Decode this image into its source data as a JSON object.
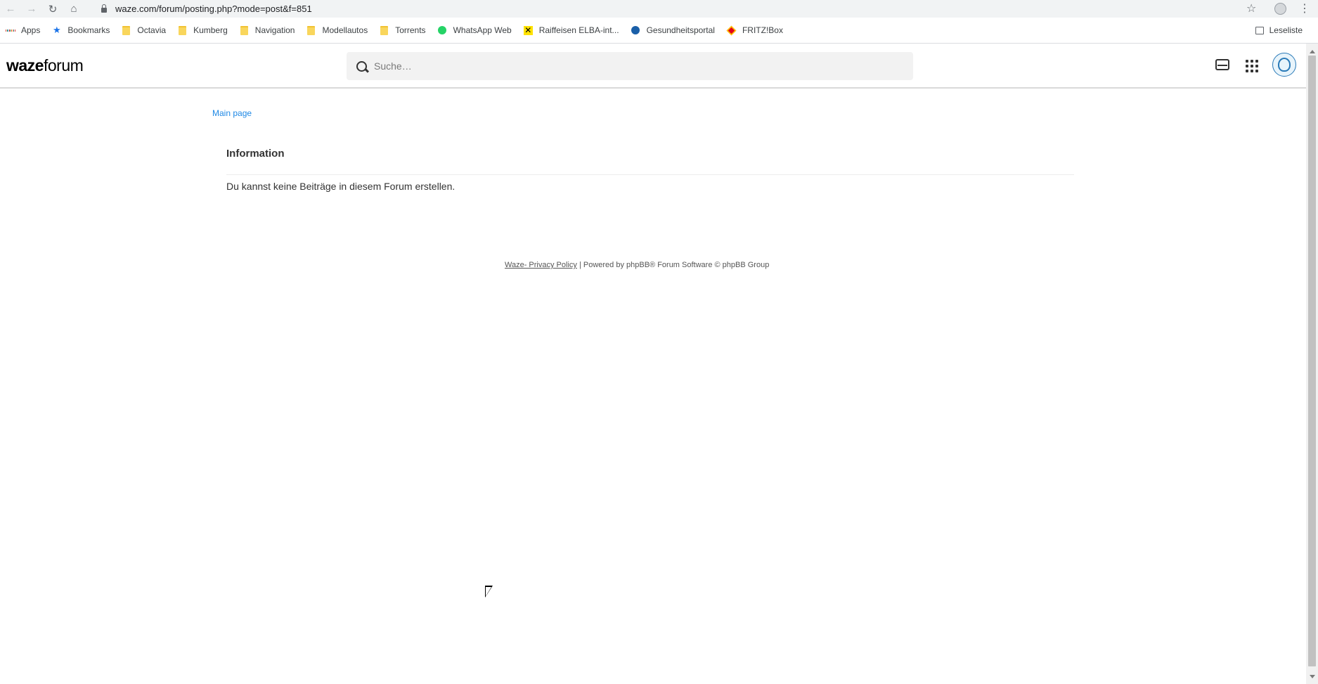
{
  "browser": {
    "url": "waze.com/forum/posting.php?mode=post&f=851",
    "icons": [
      "back-icon",
      "forward-icon",
      "reload-icon",
      "home-icon",
      "lock-icon",
      "star-icon",
      "profile-icon",
      "menu-icon"
    ],
    "bookmarks": [
      {
        "label": "Apps",
        "icon": "apps-icon"
      },
      {
        "label": "Bookmarks",
        "icon": "star-icon"
      },
      {
        "label": "Octavia",
        "icon": "folder-icon"
      },
      {
        "label": "Kumberg",
        "icon": "folder-icon"
      },
      {
        "label": "Navigation",
        "icon": "folder-icon"
      },
      {
        "label": "Modellautos",
        "icon": "folder-icon"
      },
      {
        "label": "Torrents",
        "icon": "folder-icon"
      },
      {
        "label": "WhatsApp Web",
        "icon": "whatsapp-icon"
      },
      {
        "label": "Raiffeisen ELBA-int...",
        "icon": "raiffeisen-icon"
      },
      {
        "label": "Gesundheitsportal",
        "icon": "gesundheitsportal-icon"
      },
      {
        "label": "FRITZ!Box",
        "icon": "fritzbox-icon"
      }
    ],
    "reading_list": "Leseliste"
  },
  "header": {
    "logo_bold": "waze",
    "logo_light": "forum",
    "search_placeholder": "Suche…"
  },
  "breadcrumb": "Main page",
  "panel": {
    "title": "Information",
    "message": "Du kannst keine Beiträge in diesem Forum erstellen."
  },
  "footer": {
    "privacy_link": "Waze- Privacy Policy",
    "powered_by": " | Powered by phpBB® Forum Software © phpBB Group"
  },
  "colors": {
    "link": "#1e88e5",
    "header_border": "#d9d9d9",
    "search_bg": "#f2f2f2"
  }
}
